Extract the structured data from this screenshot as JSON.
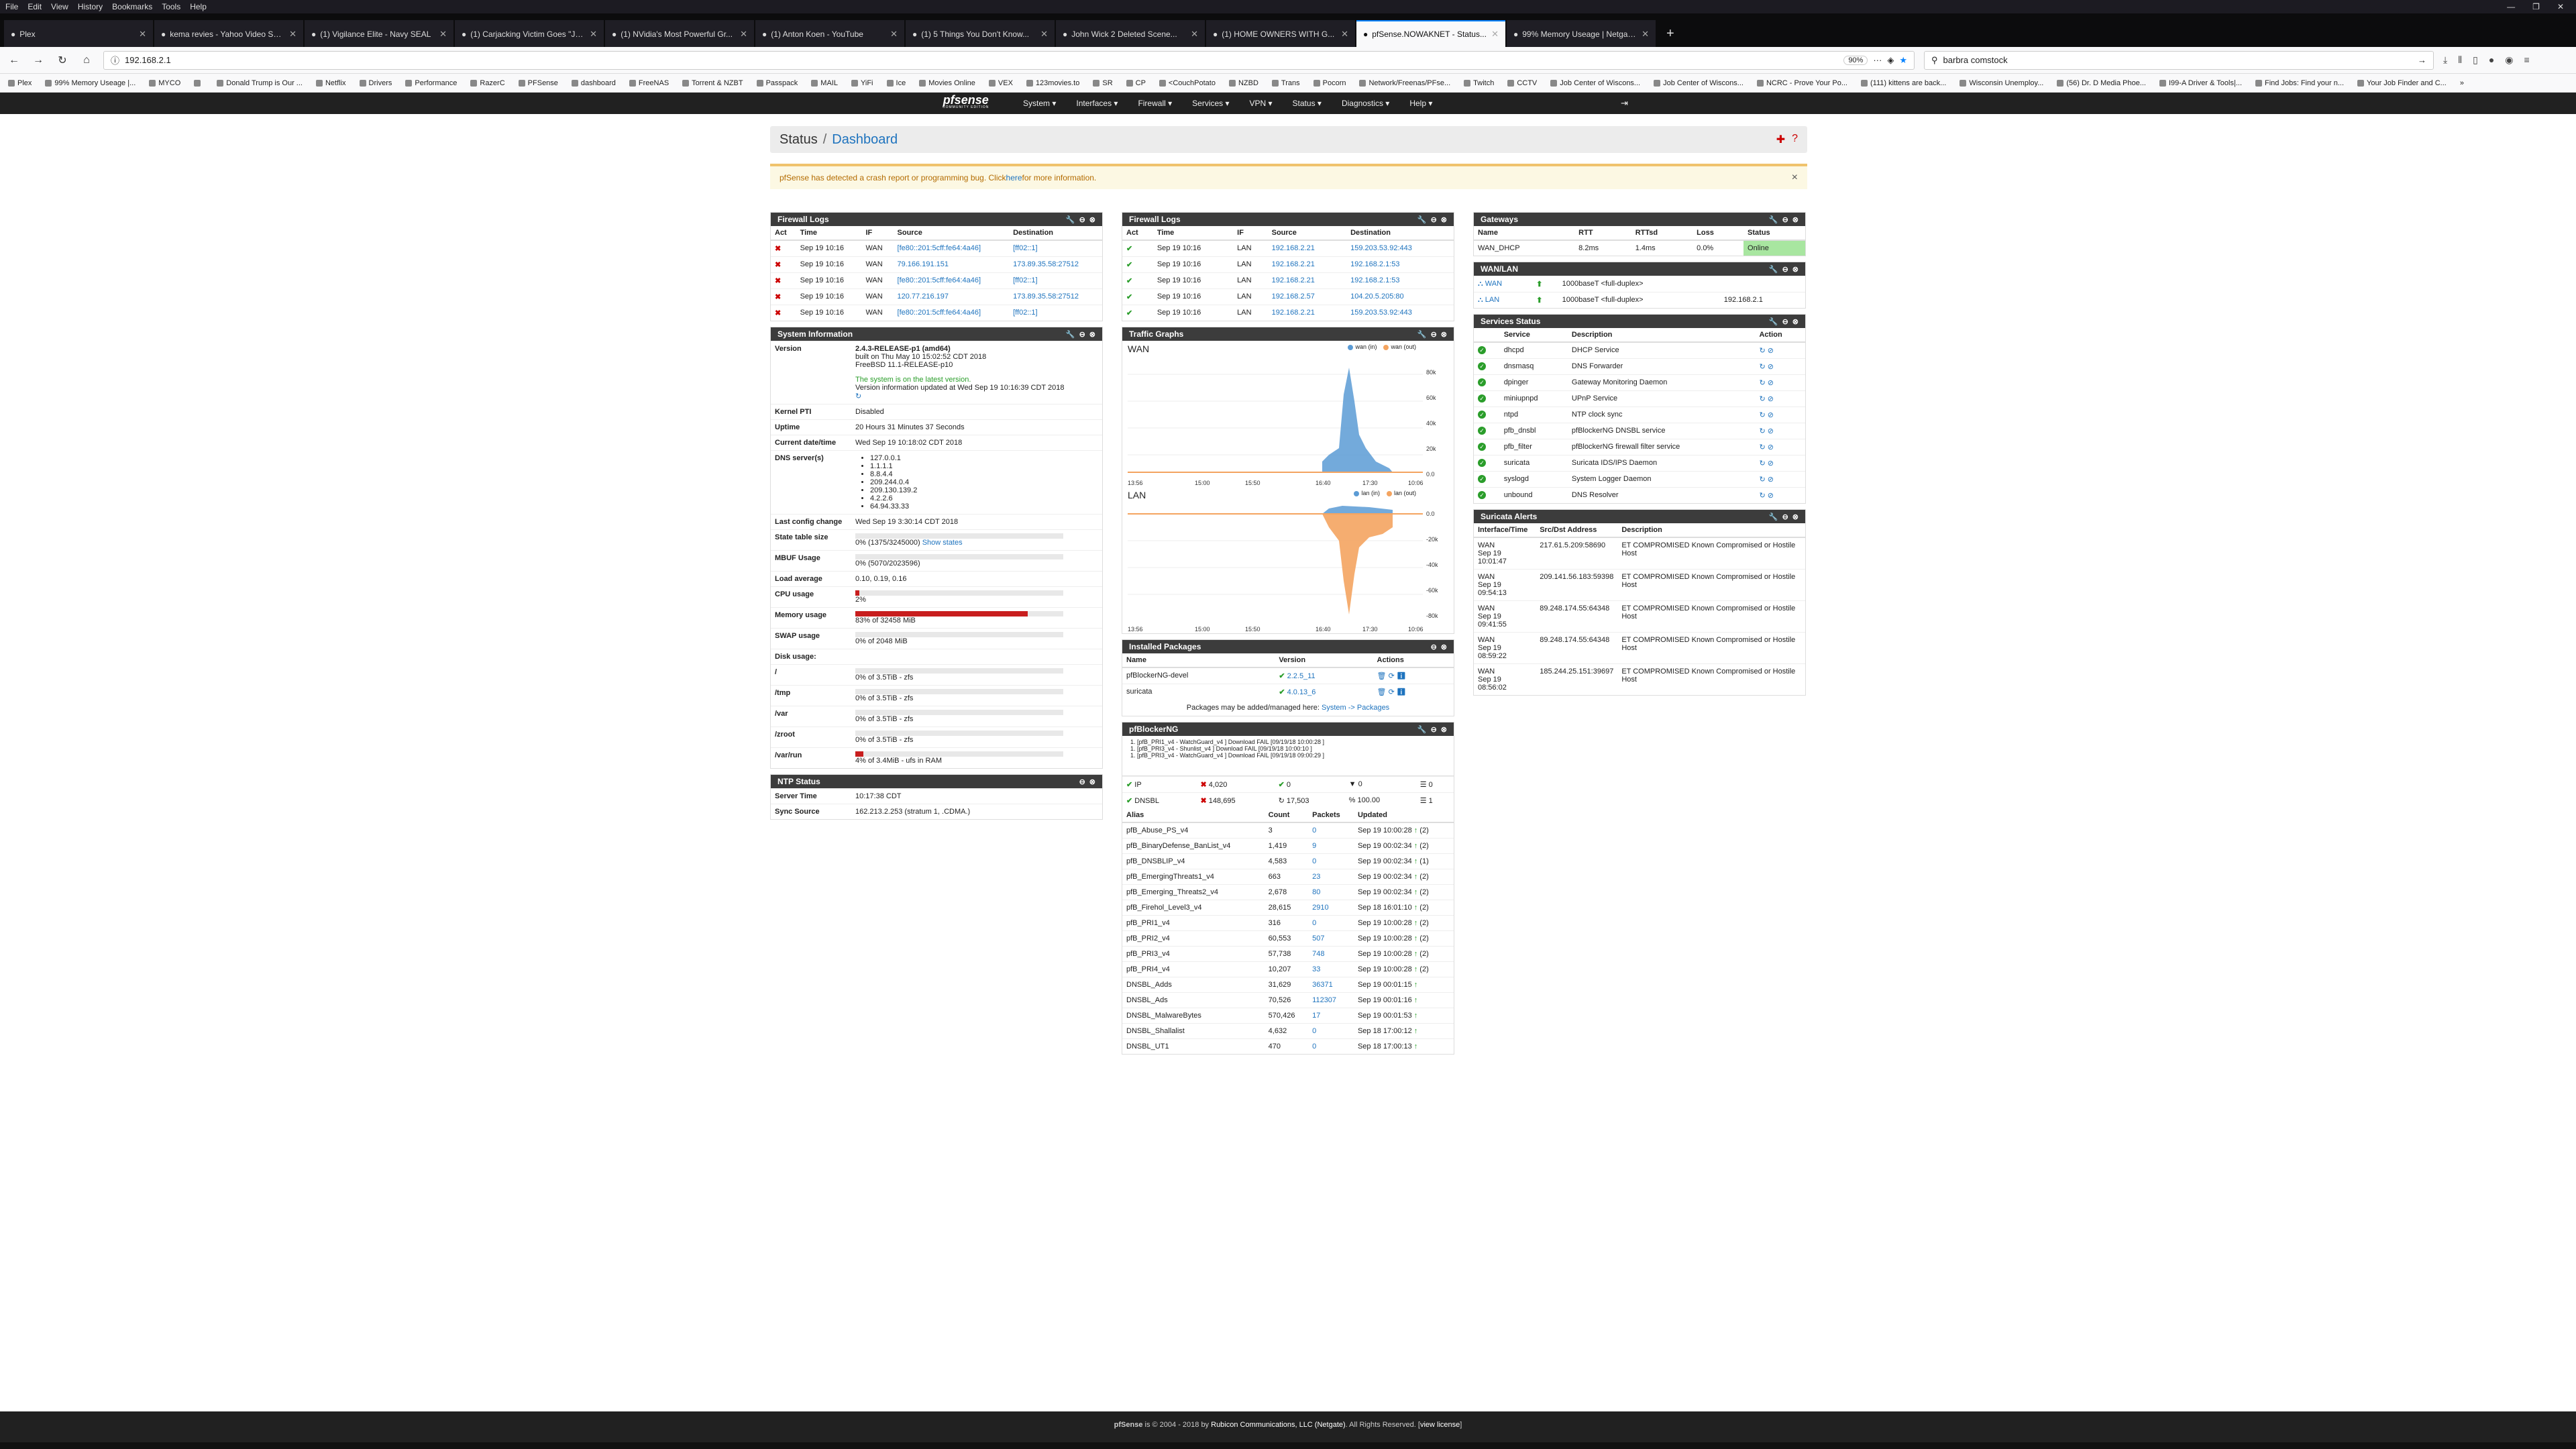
{
  "browser": {
    "menu": [
      "File",
      "Edit",
      "View",
      "History",
      "Bookmarks",
      "Tools",
      "Help"
    ],
    "tabs": [
      {
        "title": "Plex"
      },
      {
        "title": "kema revies - Yahoo Video Search"
      },
      {
        "title": "(1) Vigilance Elite - Navy SEAL"
      },
      {
        "title": "(1) Carjacking Victim Goes \"Jo..."
      },
      {
        "title": "(1) NVidia's Most Powerful Gr..."
      },
      {
        "title": "(1) Anton Koen - YouTube"
      },
      {
        "title": "(1) 5 Things You Don't Know..."
      },
      {
        "title": "John Wick 2 Deleted Scene..."
      },
      {
        "title": "(1) HOME OWNERS WITH G..."
      },
      {
        "title": "pfSense.NOWAKNET - Status..."
      },
      {
        "title": "99% Memory Useage | Netgate..."
      }
    ],
    "url": "192.168.2.1",
    "zoom": "90%",
    "search": "barbra comstock",
    "bookmarks": [
      "Plex",
      "99% Memory Useage |...",
      "MYCO",
      "",
      "Donald Trump is Our ...",
      "Netflix",
      "Drivers",
      "Performance",
      "RazerC",
      "PFSense",
      "dashboard",
      "FreeNAS",
      "Torrent & NZBT",
      "Passpack",
      "MAIL",
      "YiFi",
      "Ice",
      "Movies Online",
      "VEX",
      "123movies.to",
      "SR",
      "CP",
      "<CouchPotato",
      "NZBD",
      "Trans",
      "Pocorn",
      "Network/Freenas/PFse...",
      "Twitch",
      "CCTV",
      "Job Center of Wiscons...",
      "Job Center of Wiscons...",
      "NCRC - Prove Your Po...",
      "(111) kittens are back...",
      "Wisconsin Unemploy...",
      "(56) Dr. D Media Phoe...",
      "I99-A Driver & Tools|...",
      "Find Jobs: Find your n...",
      "Your Job Finder and C..."
    ]
  },
  "pf": {
    "logo": "pfsense",
    "edition": "COMMUNITY EDITION",
    "menu": [
      "System",
      "Interfaces",
      "Firewall",
      "Services",
      "VPN",
      "Status",
      "Diagnostics",
      "Help"
    ],
    "breadcrumb": {
      "root": "Status",
      "sep": "/",
      "page": "Dashboard"
    },
    "alert": {
      "text": "pfSense has detected a crash report or programming bug. Click ",
      "link": "here",
      "tail": " for more information."
    },
    "fw1": {
      "title": "Firewall Logs",
      "cols": [
        "Act",
        "Time",
        "IF",
        "Source",
        "Destination"
      ],
      "rows": [
        [
          "x",
          "Sep 19 10:16",
          "WAN",
          "[fe80::201:5cff:fe64:4a46]",
          "[ff02::1]"
        ],
        [
          "x",
          "Sep 19 10:16",
          "WAN",
          "79.166.191.151",
          "173.89.35.58:27512"
        ],
        [
          "x",
          "Sep 19 10:16",
          "WAN",
          "[fe80::201:5cff:fe64:4a46]",
          "[ff02::1]"
        ],
        [
          "x",
          "Sep 19 10:16",
          "WAN",
          "120.77.216.197",
          "173.89.35.58:27512"
        ],
        [
          "x",
          "Sep 19 10:16",
          "WAN",
          "[fe80::201:5cff:fe64:4a46]",
          "[ff02::1]"
        ]
      ]
    },
    "fw2": {
      "title": "Firewall Logs",
      "cols": [
        "Act",
        "Time",
        "IF",
        "Source",
        "Destination"
      ],
      "rows": [
        [
          "ok",
          "Sep 19 10:16",
          "LAN",
          "192.168.2.21",
          "159.203.53.92:443"
        ],
        [
          "ok",
          "Sep 19 10:16",
          "LAN",
          "192.168.2.21",
          "192.168.2.1:53"
        ],
        [
          "ok",
          "Sep 19 10:16",
          "LAN",
          "192.168.2.21",
          "192.168.2.1:53"
        ],
        [
          "ok",
          "Sep 19 10:16",
          "LAN",
          "192.168.2.57",
          "104.20.5.205:80"
        ],
        [
          "ok",
          "Sep 19 10:16",
          "LAN",
          "192.168.2.21",
          "159.203.53.92:443"
        ]
      ]
    },
    "sysinfo": {
      "title": "System Information",
      "version_label": "Version",
      "version": "2.4.3-RELEASE-p1 (amd64)",
      "built": "built on Thu May 10 15:02:52 CDT 2018",
      "freebsd": "FreeBSD 11.1-RELEASE-p10",
      "latest": "The system is on the latest version.",
      "updated": "Version information updated at Wed Sep 19 10:16:39 CDT 2018",
      "kpti_label": "Kernel PTI",
      "kpti": "Disabled",
      "uptime_label": "Uptime",
      "uptime": "20 Hours 31 Minutes 37 Seconds",
      "date_label": "Current date/time",
      "date": "Wed Sep 19 10:18:02 CDT 2018",
      "dns_label": "DNS server(s)",
      "dns": [
        "127.0.0.1",
        "1.1.1.1",
        "8.8.4.4",
        "209.244.0.4",
        "209.130.139.2",
        "4.2.2.6",
        "64.94.33.33"
      ],
      "lastcfg_label": "Last config change",
      "lastcfg": "Wed Sep 19 3:30:14 CDT 2018",
      "state_label": "State table size",
      "state": "0% (1375/3245000)",
      "show_states": "Show states",
      "mbuf_label": "MBUF Usage",
      "mbuf": "0% (5070/2023596)",
      "load_label": "Load average",
      "load": "0.10, 0.19, 0.16",
      "cpu_label": "CPU usage",
      "cpu": "2%",
      "cpu_pct": 2,
      "mem_label": "Memory usage",
      "mem": "83% of 32458 MiB",
      "mem_pct": 83,
      "swap_label": "SWAP usage",
      "swap": "0% of 2048 MiB",
      "disk_label": "Disk usage:",
      "disks": [
        {
          "mount": "/",
          "val": "0% of 3.5TiB - zfs",
          "pct": 0
        },
        {
          "mount": "/tmp",
          "val": "0% of 3.5TiB - zfs",
          "pct": 0
        },
        {
          "mount": "/var",
          "val": "0% of 3.5TiB - zfs",
          "pct": 0
        },
        {
          "mount": "/zroot",
          "val": "0% of 3.5TiB - zfs",
          "pct": 0
        },
        {
          "mount": "/var/run",
          "val": "4% of 3.4MiB - ufs in RAM",
          "pct": 4
        }
      ]
    },
    "ntp": {
      "title": "NTP Status",
      "time_label": "Server Time",
      "time": "10:17:38 CDT",
      "sync_label": "Sync Source",
      "sync": "162.213.2.253 (stratum 1, .CDMA.)"
    },
    "traffic": {
      "title": "Traffic Graphs",
      "wan": {
        "name": "WAN",
        "in": "wan (in)",
        "out": "wan (out)",
        "yticks": [
          "80k",
          "60k",
          "40k",
          "20k",
          "0.0"
        ],
        "xticks": [
          "13:56",
          "15:00",
          "15:50",
          "16:40",
          "17:30",
          "10:06"
        ]
      },
      "lan": {
        "name": "LAN",
        "in": "lan (in)",
        "out": "lan (out)",
        "yticks": [
          "0.0",
          "-20k",
          "-40k",
          "-60k",
          "-80k"
        ],
        "xticks": [
          "13:56",
          "15:00",
          "15:50",
          "16:40",
          "17:30",
          "10:06"
        ]
      },
      "in_color": "#5b9bd5",
      "out_color": "#f4a460"
    },
    "packages": {
      "title": "Installed Packages",
      "cols": [
        "Name",
        "Version",
        "Actions"
      ],
      "rows": [
        [
          "pfBlockerNG-devel",
          "2.2.5_11"
        ],
        [
          "suricata",
          "4.0.13_6"
        ]
      ],
      "note": "Packages may be added/managed here: ",
      "note_link": "System -> Packages"
    },
    "pfb": {
      "title": "pfBlockerNG",
      "log": [
        "1. [pfB_PRI1_v4 - WatchGuard_v4 ] Download FAIL [09/19/18 10:00:28 ]",
        "1. [pfB_PRI3_v4 - Shunlist_v4 ] Download FAIL [09/19/18 10:00:10 ]",
        "1. [pfB_PRI3_v4 - WatchGuard_v4 ] Download FAIL [09/19/18 09:00:29 ]"
      ],
      "ip": {
        "label": "IP",
        "a": "4,020",
        "b": "0",
        "c": "0",
        "d": "0"
      },
      "dnsbl": {
        "label": "DNSBL",
        "a": "148,695",
        "b": "17,503",
        "c": "100.00",
        "d": "1"
      },
      "cols": [
        "Alias",
        "Count",
        "Packets",
        "Updated"
      ],
      "rows": [
        [
          "pfB_Abuse_PS_v4",
          "3",
          "0",
          "Sep 19 10:00:28",
          "(2)"
        ],
        [
          "pfB_BinaryDefense_BanList_v4",
          "1,419",
          "9",
          "Sep 19 00:02:34",
          "(2)"
        ],
        [
          "pfB_DNSBLIP_v4",
          "4,583",
          "0",
          "Sep 19 00:02:34",
          "(1)"
        ],
        [
          "pfB_EmergingThreats1_v4",
          "663",
          "23",
          "Sep 19 00:02:34",
          "(2)"
        ],
        [
          "pfB_Emerging_Threats2_v4",
          "2,678",
          "80",
          "Sep 19 00:02:34",
          "(2)"
        ],
        [
          "pfB_Firehol_Level3_v4",
          "28,615",
          "2910",
          "Sep 18 16:01:10",
          "(2)"
        ],
        [
          "pfB_PRI1_v4",
          "316",
          "0",
          "Sep 19 10:00:28",
          "(2)"
        ],
        [
          "pfB_PRI2_v4",
          "60,553",
          "507",
          "Sep 19 10:00:28",
          "(2)"
        ],
        [
          "pfB_PRI3_v4",
          "57,738",
          "748",
          "Sep 19 10:00:28",
          "(2)"
        ],
        [
          "pfB_PRI4_v4",
          "10,207",
          "33",
          "Sep 19 10:00:28",
          "(2)"
        ],
        [
          "DNSBL_Adds",
          "31,629",
          "36371",
          "Sep 19 00:01:15",
          ""
        ],
        [
          "DNSBL_Ads",
          "70,526",
          "112307",
          "Sep 19 00:01:16",
          ""
        ],
        [
          "DNSBL_MalwareBytes",
          "570,426",
          "17",
          "Sep 19 00:01:53",
          ""
        ],
        [
          "DNSBL_Shallalist",
          "4,632",
          "0",
          "Sep 18 17:00:12",
          ""
        ],
        [
          "DNSBL_UT1",
          "470",
          "0",
          "Sep 18 17:00:13",
          ""
        ]
      ]
    },
    "gw": {
      "title": "Gateways",
      "cols": [
        "Name",
        "RTT",
        "RTTsd",
        "Loss",
        "Status"
      ],
      "rows": [
        [
          "WAN_DHCP",
          "8.2ms",
          "1.4ms",
          "0.0%",
          "Online"
        ]
      ]
    },
    "wanlan": {
      "title": "WAN/LAN",
      "rows": [
        [
          "WAN",
          "1000baseT <full-duplex>",
          ""
        ],
        [
          "LAN",
          "1000baseT <full-duplex>",
          "192.168.2.1"
        ]
      ]
    },
    "services": {
      "title": "Services Status",
      "cols": [
        "Service",
        "Description",
        "Action"
      ],
      "rows": [
        [
          "dhcpd",
          "DHCP Service"
        ],
        [
          "dnsmasq",
          "DNS Forwarder"
        ],
        [
          "dpinger",
          "Gateway Monitoring Daemon"
        ],
        [
          "miniupnpd",
          "UPnP Service"
        ],
        [
          "ntpd",
          "NTP clock sync"
        ],
        [
          "pfb_dnsbl",
          "pfBlockerNG DNSBL service"
        ],
        [
          "pfb_filter",
          "pfBlockerNG firewall filter service"
        ],
        [
          "suricata",
          "Suricata IDS/IPS Daemon"
        ],
        [
          "syslogd",
          "System Logger Daemon"
        ],
        [
          "unbound",
          "DNS Resolver"
        ]
      ]
    },
    "suricata": {
      "title": "Suricata Alerts",
      "cols": [
        "Interface/Time",
        "Src/Dst Address",
        "Description"
      ],
      "rows": [
        [
          "WAN",
          "Sep 19 10:01:47",
          "217.61.5.209:58690",
          "ET COMPROMISED Known Compromised or Hostile Host"
        ],
        [
          "WAN",
          "Sep 19 09:54:13",
          "209.141.56.183:59398",
          "ET COMPROMISED Known Compromised or Hostile Host"
        ],
        [
          "WAN",
          "Sep 19 09:41:55",
          "89.248.174.55:64348",
          "ET COMPROMISED Known Compromised or Hostile Host"
        ],
        [
          "WAN",
          "Sep 19 08:59:22",
          "89.248.174.55:64348",
          "ET COMPROMISED Known Compromised or Hostile Host"
        ],
        [
          "WAN",
          "Sep 19 08:56:02",
          "185.244.25.151:39697",
          "ET COMPROMISED Known Compromised or Hostile Host"
        ]
      ]
    },
    "footer": {
      "pre": "pfSense",
      "mid": " is © 2004 - 2018 by ",
      "co": "Rubicon Communications, LLC (Netgate)",
      "post": ". All Rights Reserved. [",
      "lic": "view license",
      "end": "]"
    }
  }
}
